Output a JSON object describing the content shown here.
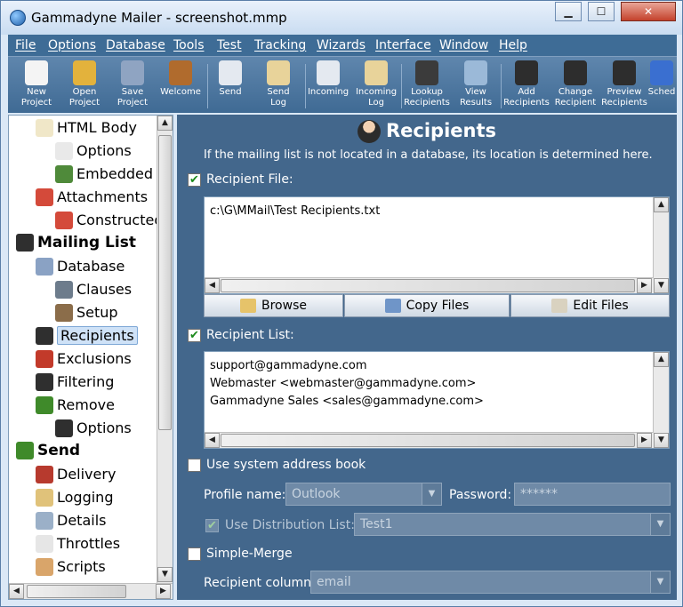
{
  "window": {
    "title": "Gammadyne Mailer - screenshot.mmp",
    "minimize": "▁",
    "maximize": "☐",
    "close": "✕"
  },
  "menu": [
    "File",
    "Options",
    "Database",
    "Tools",
    "Test",
    "Tracking",
    "Wizards",
    "Interface",
    "Window",
    "Help"
  ],
  "toolbar": [
    {
      "l1": "New",
      "l2": "Project",
      "color": "#f4f4f4"
    },
    {
      "l1": "Open",
      "l2": "Project",
      "color": "#e3b23c"
    },
    {
      "l1": "Save",
      "l2": "Project",
      "color": "#8fa4c2"
    },
    {
      "l1": "Welcome",
      "l2": "",
      "color": "#b06b2d"
    },
    {
      "l1": "Send",
      "l2": "",
      "color": "#e4e9f0"
    },
    {
      "l1": "Send",
      "l2": "Log",
      "color": "#e8d39a"
    },
    {
      "l1": "Incoming",
      "l2": "",
      "color": "#e4e9f0"
    },
    {
      "l1": "Incoming",
      "l2": "Log",
      "color": "#e8d39a"
    },
    {
      "l1": "Lookup",
      "l2": "Recipients",
      "color": "#3b3b3b"
    },
    {
      "l1": "View",
      "l2": "Results",
      "color": "#9bb9d8"
    },
    {
      "l1": "Add",
      "l2": "Recipients",
      "color": "#2d2d2d"
    },
    {
      "l1": "Change",
      "l2": "Recipient",
      "color": "#2d2d2d"
    },
    {
      "l1": "Preview",
      "l2": "Recipients",
      "color": "#2d2d2d"
    },
    {
      "l1": "Sched",
      "l2": "",
      "color": "#3a6fd0"
    }
  ],
  "tree": [
    {
      "label": "HTML Body",
      "level": 1,
      "color": "#f0e7c8"
    },
    {
      "label": "Options",
      "level": 2,
      "color": "#e9e9e9"
    },
    {
      "label": "Embedded I",
      "level": 2,
      "color": "#4f8a3a"
    },
    {
      "label": "Attachments",
      "level": 1,
      "color": "#d44a3a"
    },
    {
      "label": "Constructed",
      "level": 2,
      "color": "#d44a3a"
    },
    {
      "label": "Mailing List",
      "level": 0,
      "color": "#2f2f2f",
      "bold": true
    },
    {
      "label": "Database",
      "level": 1,
      "color": "#8aa2c4"
    },
    {
      "label": "Clauses",
      "level": 2,
      "color": "#6d7c8c"
    },
    {
      "label": "Setup",
      "level": 2,
      "color": "#8b6d4a"
    },
    {
      "label": "Recipients",
      "level": 1,
      "color": "#2f2f2f",
      "selected": true
    },
    {
      "label": "Exclusions",
      "level": 1,
      "color": "#c23a2a"
    },
    {
      "label": "Filtering",
      "level": 1,
      "color": "#2f2f2f"
    },
    {
      "label": "Remove",
      "level": 1,
      "color": "#3f8a2a"
    },
    {
      "label": "Options",
      "level": 2,
      "color": "#2f2f2f"
    },
    {
      "label": "Send",
      "level": 0,
      "color": "#3f8a2a",
      "bold": true
    },
    {
      "label": "Delivery",
      "level": 1,
      "color": "#b73a2e"
    },
    {
      "label": "Logging",
      "level": 1,
      "color": "#e0c27a"
    },
    {
      "label": "Details",
      "level": 1,
      "color": "#9bb0c8"
    },
    {
      "label": "Throttles",
      "level": 1,
      "color": "#e6e6e6"
    },
    {
      "label": "Scripts",
      "level": 1,
      "color": "#d9a56a"
    }
  ],
  "panel": {
    "title": "Recipients",
    "description": "If the mailing list is not located in a database, its location is determined here.",
    "recipient_file": {
      "label": "Recipient File:",
      "checked": true,
      "value": "c:\\G\\MMail\\Test Recipients.txt"
    },
    "buttons": {
      "browse": "Browse",
      "copy": "Copy Files",
      "edit": "Edit Files"
    },
    "recipient_list": {
      "label": "Recipient List:",
      "checked": true,
      "lines": [
        "support@gammadyne.com",
        "Webmaster <webmaster@gammadyne.com>",
        "Gammadyne Sales <sales@gammadyne.com>"
      ]
    },
    "address_book": {
      "label": "Use system address book",
      "checked": false
    },
    "profile": {
      "label": "Profile name:",
      "value": "Outlook"
    },
    "password": {
      "label": "Password:",
      "value": "******"
    },
    "distribution": {
      "label": "Use Distribution List:",
      "checked": true,
      "value": "Test1"
    },
    "simple_merge": {
      "label": "Simple-Merge",
      "checked": false
    },
    "recipient_column": {
      "label": "Recipient column:",
      "value": "email"
    },
    "check_mark": "✔"
  },
  "icons": {
    "up": "▲",
    "down": "▼",
    "left": "◀",
    "right": "▶",
    "dropdown": "▼",
    "grip": "|||"
  }
}
